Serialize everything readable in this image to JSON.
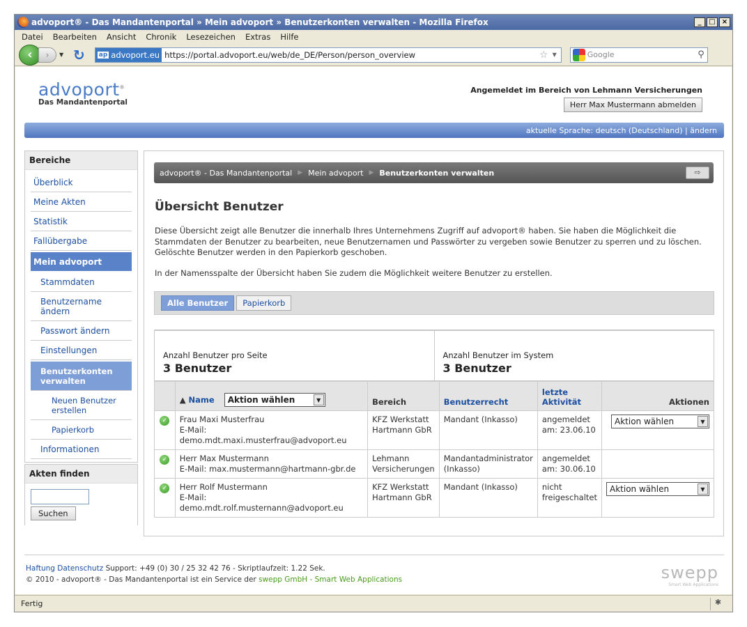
{
  "window": {
    "title": "advoport® - Das Mandantenportal  »  Mein advoport  »  Benutzerkonten verwalten - Mozilla Firefox",
    "controls": [
      "_",
      "□",
      "×"
    ]
  },
  "menu": [
    "Datei",
    "Bearbeiten",
    "Ansicht",
    "Chronik",
    "Lesezeichen",
    "Extras",
    "Hilfe"
  ],
  "nav": {
    "site_badge": "ap",
    "site_identity": "advoport.eu",
    "url": "https://portal.advoport.eu/web/de_DE/Person/person_overview",
    "search_placeholder": "Google"
  },
  "header": {
    "logo_main": "advoport",
    "logo_sub": "Das Mandantenportal",
    "login_info": "Angemeldet im Bereich von Lehmann Versicherungen",
    "logout_label": "Herr Max Mustermann abmelden",
    "language": "aktuelle Sprache: deutsch (Deutschland) | ändern"
  },
  "sidebar": {
    "title": "Bereiche",
    "items": [
      {
        "label": "Überblick"
      },
      {
        "label": "Meine Akten"
      },
      {
        "label": "Statistik"
      },
      {
        "label": "Fallübergabe"
      },
      {
        "label": "Mein advoport"
      },
      {
        "label": "Stammdaten"
      },
      {
        "label": "Benutzername ändern"
      },
      {
        "label": "Passwort ändern"
      },
      {
        "label": "Einstellungen"
      },
      {
        "label": "Benutzerkonten verwalten"
      },
      {
        "label": "Neuen Benutzer erstellen"
      },
      {
        "label": "Papierkorb"
      },
      {
        "label": "Informationen"
      }
    ],
    "search_title": "Akten finden",
    "search_value": "",
    "search_button": "Suchen"
  },
  "breadcrumb": [
    "advoport® - Das Mandantenportal",
    "Mein advoport",
    "Benutzerkonten verwalten"
  ],
  "page": {
    "title": "Übersicht Benutzer",
    "desc1": "Diese Übersicht zeigt alle Benutzer die innerhalb Ihres Unternehmens Zugriff auf advoport® haben. Sie haben die Möglichkeit die Stammdaten der Benutzer zu bearbeiten, neue Benutzernamen und Passwörter zu vergeben sowie Benutzer zu sperren und zu löschen. Gelöschte Benutzer werden in den Papierkorb geschoben.",
    "desc2": "In der Namensspalte der Übersicht haben Sie zudem die Möglichkeit weitere Benutzer zu erstellen.",
    "tabs": [
      "Alle Benutzer",
      "Papierkorb"
    ],
    "stats": [
      {
        "label": "Anzahl Benutzer pro Seite",
        "value": "3 Benutzer"
      },
      {
        "label": "Anzahl Benutzer im System",
        "value": "3 Benutzer"
      }
    ]
  },
  "table": {
    "sort_arrow": "▲",
    "headers": {
      "name": "Name",
      "action_select": "Aktion wählen",
      "bereich": "Bereich",
      "recht": "Benutzerrecht",
      "aktivitaet_1": "letzte",
      "aktivitaet_2": "Aktivität",
      "aktionen": "Aktionen"
    },
    "rows": [
      {
        "name": "Frau Maxi Musterfrau",
        "email": "E-Mail: demo.mdt.maxi.musterfrau@advoport.eu",
        "bereich_1": "KFZ Werkstatt",
        "bereich_2": "Hartmann GbR",
        "recht": "Mandant (Inkasso)",
        "akt_1": "angemeldet",
        "akt_2": "am: 23.06.10",
        "aktion": "Aktion wählen"
      },
      {
        "name": "Herr Max Mustermann",
        "email": "E-Mail: max.mustermann@hartmann-gbr.de",
        "bereich_1": "Lehmann",
        "bereich_2": "Versicherungen",
        "recht": "Mandantadministrator (Inkasso)",
        "akt_1": "angemeldet",
        "akt_2": "am: 30.06.10",
        "aktion": ""
      },
      {
        "name": "Herr Rolf Mustermann",
        "email": "E-Mail: demo.mdt.rolf.musternann@advoport.eu",
        "bereich_1": "KFZ Werkstatt",
        "bereich_2": "Hartmann GbR",
        "recht": "Mandant (Inkasso)",
        "akt_1": "nicht",
        "akt_2": "freigeschaltet",
        "aktion": "Aktion wählen"
      }
    ]
  },
  "footer": {
    "haftung": "Haftung",
    "datenschutz": "Datenschutz",
    "support": "Support: +49 (0) 30 / 25 32 42 76 - Skriptlaufzeit: 1.22 Sek.",
    "copyright": "© 2010 - advoport® - Das Mandantenportal ist ein Service der ",
    "company": "swepp GmbH - Smart Web Applications",
    "brand": "swepp",
    "brand_sub": "Smart Web Applications"
  },
  "status": "Fertig"
}
